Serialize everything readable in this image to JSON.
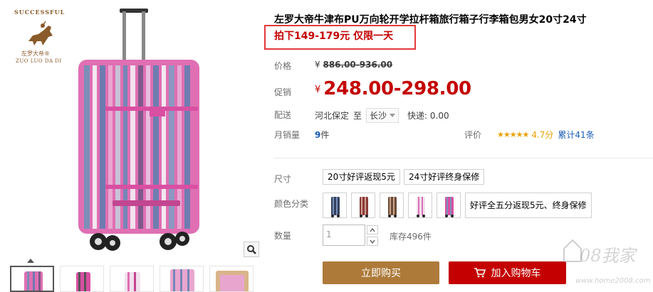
{
  "brand": {
    "arc_text": "SUCCESSFUL",
    "cn_name": "左罗大帝®",
    "en_name": "ZUO LUO DA DI"
  },
  "product": {
    "title": "左罗大帝牛津布PU万向轮开学拉杆箱旅行箱子行李箱包男女20寸24寸",
    "promo": "拍下149-179元 仅限一天"
  },
  "pricing": {
    "orig_label": "价格",
    "orig_currency": "¥",
    "orig_value": "886.00-936.00",
    "sale_label": "促销",
    "sale_currency": "¥",
    "sale_value": "248.00-298.00"
  },
  "shipping": {
    "label": "配送",
    "from": "河北保定",
    "to_word": "至",
    "dest": "长沙",
    "fee": "快递: 0.00"
  },
  "sales": {
    "label": "月销量",
    "count": "9",
    "unit": "件",
    "rating_label": "评价",
    "stars": "★★★★★",
    "score": "4.7分",
    "reviews": "累计41条"
  },
  "sku": {
    "size_label": "尺寸",
    "sizes": [
      "20寸好评返现5元",
      "24寸好评终身保修"
    ],
    "color_label": "颜色分类",
    "color_note": "好评全五分返现5元、终身保修",
    "qty_label": "数量",
    "qty_value": "1",
    "stock": "库存496件"
  },
  "actions": {
    "buy_now": "立即购买",
    "add_cart": "加入购物车"
  },
  "watermark": {
    "text": "08我家",
    "url": "www.home2008.com"
  },
  "colors": {
    "accent_red": "#c40000",
    "buy_brown": "#ad7a3a",
    "link_blue": "#1a5db5"
  }
}
